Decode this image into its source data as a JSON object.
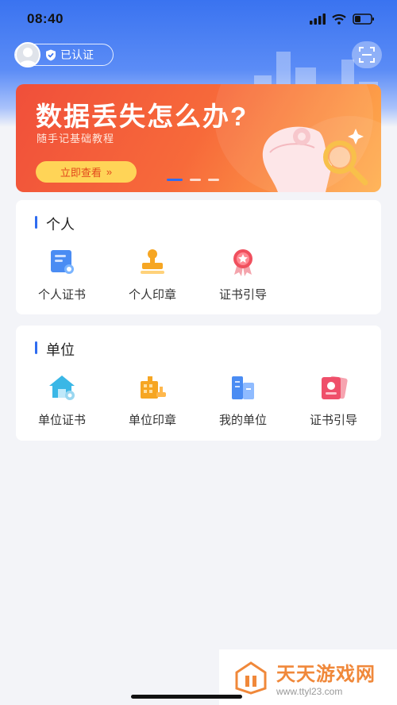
{
  "status_bar": {
    "time": "08:40"
  },
  "header": {
    "verified_label": "已认证"
  },
  "banner": {
    "title": "数据丢失怎么办?",
    "subtitle": "随手记基础教程",
    "cta_label": "立即查看",
    "cta_arrow": "»"
  },
  "personal": {
    "title": "个人",
    "items": [
      {
        "label": "个人证书",
        "icon": "certificate-icon"
      },
      {
        "label": "个人印章",
        "icon": "stamp-icon"
      },
      {
        "label": "证书引导",
        "icon": "award-icon"
      }
    ]
  },
  "organization": {
    "title": "单位",
    "items": [
      {
        "label": "单位证书",
        "icon": "house-certificate-icon"
      },
      {
        "label": "单位印章",
        "icon": "org-stamp-icon"
      },
      {
        "label": "我的单位",
        "icon": "buildings-icon"
      },
      {
        "label": "证书引导",
        "icon": "guide-card-icon"
      }
    ]
  },
  "watermark": {
    "title": "天天游戏网",
    "url": "www.ttyl23.com"
  },
  "colors": {
    "accent": "#2f6cf0",
    "banner": "#f04f3a",
    "cta": "#ffd457"
  }
}
